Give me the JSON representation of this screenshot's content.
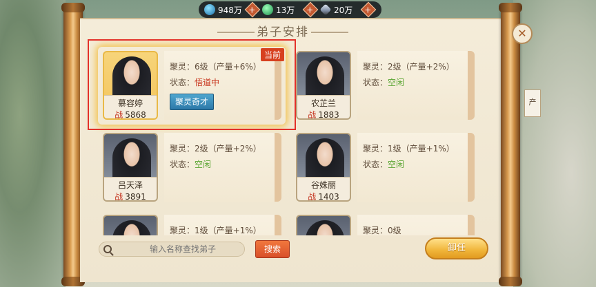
{
  "resources": [
    {
      "icon": "spirit-stone-icon",
      "value": "948万"
    },
    {
      "icon": "jade-icon",
      "value": "13万"
    },
    {
      "icon": "sword-icon",
      "value": "20万"
    }
  ],
  "panel_title": "弟子安排",
  "side_hint": "产",
  "disciples": [
    {
      "name": "慕容婷",
      "power_prefix": "战",
      "power": "5868",
      "ability_label": "聚灵：",
      "ability": "6级（产量+6%）",
      "status_label": "状态：",
      "status": "悟道中",
      "status_type": "busy",
      "badge": "当前",
      "skill": "聚灵奇才"
    },
    {
      "name": "农芷兰",
      "power_prefix": "战",
      "power": "1883",
      "ability_label": "聚灵：",
      "ability": "2级（产量+2%）",
      "status_label": "状态：",
      "status": "空闲",
      "status_type": "idle"
    },
    {
      "name": "吕天泽",
      "power_prefix": "战",
      "power": "3891",
      "ability_label": "聚灵：",
      "ability": "2级（产量+2%）",
      "status_label": "状态：",
      "status": "空闲",
      "status_type": "idle"
    },
    {
      "name": "谷姝丽",
      "power_prefix": "战",
      "power": "1403",
      "ability_label": "聚灵：",
      "ability": "1级（产量+1%）",
      "status_label": "状态：",
      "status": "空闲",
      "status_type": "idle"
    },
    {
      "ability_label": "聚灵：",
      "ability": "1级（产量+1%）"
    },
    {
      "ability_label": "聚灵：",
      "ability": "0级"
    }
  ],
  "search": {
    "placeholder": "输入名称查找弟子",
    "button": "搜索"
  },
  "dismiss_button": "卸任",
  "colors": {
    "accent_red": "#e3312a",
    "idle_green": "#5aa532",
    "busy_red": "#c7331b"
  }
}
